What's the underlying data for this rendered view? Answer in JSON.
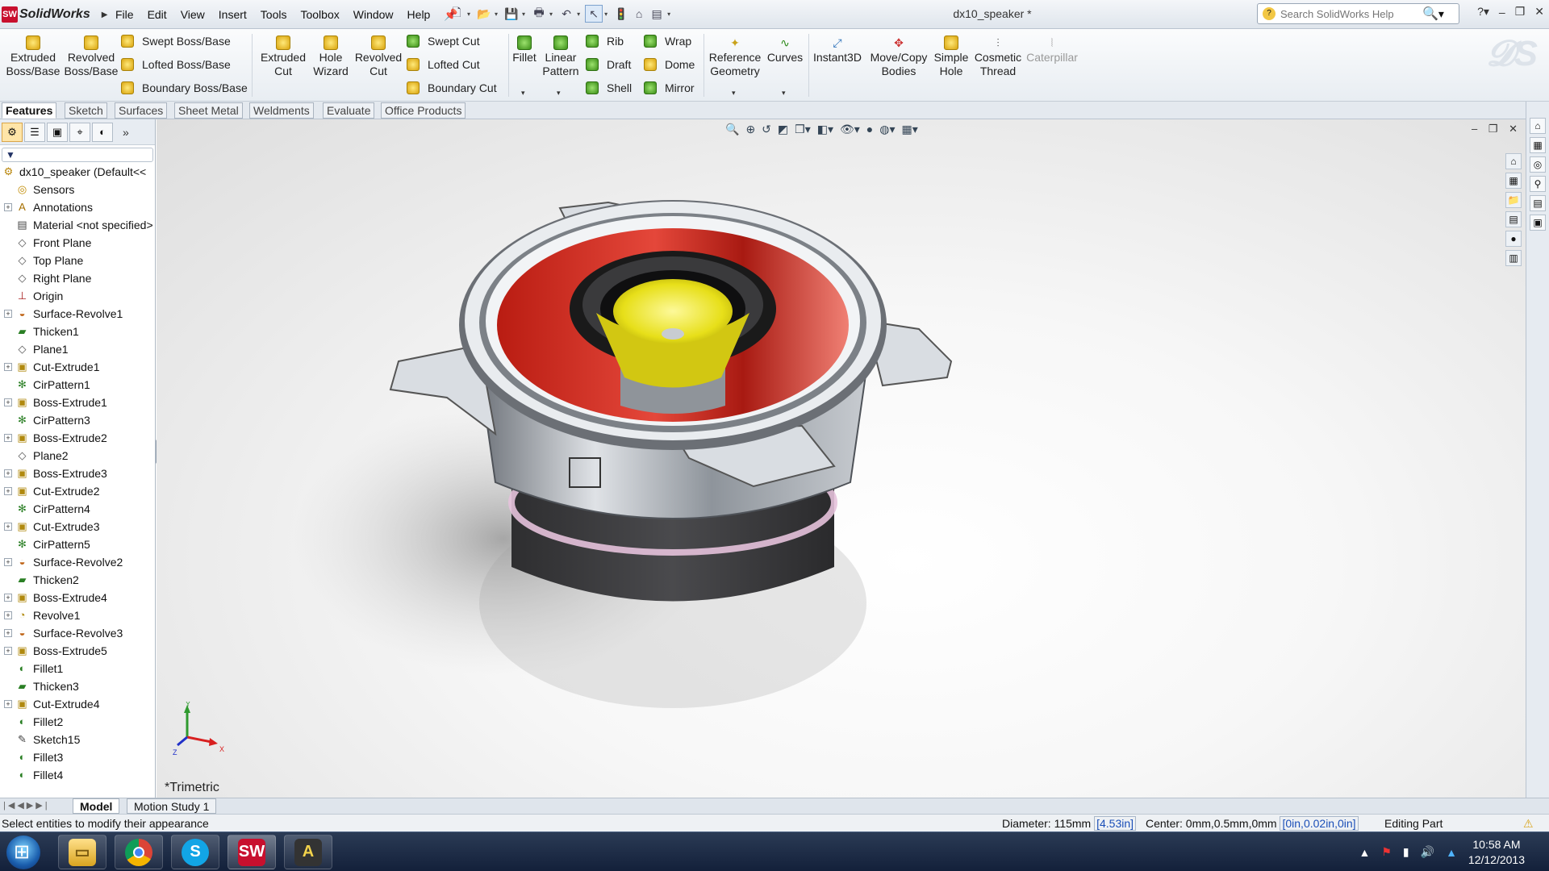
{
  "app": {
    "name": "SolidWorks",
    "document_title": "dx10_speaker *",
    "menus": [
      "File",
      "Edit",
      "View",
      "Insert",
      "Tools",
      "Toolbox",
      "Window",
      "Help"
    ],
    "search_placeholder": "Search SolidWorks Help"
  },
  "command_manager": {
    "big_buttons": [
      {
        "label1": "Extruded",
        "label2": "Boss/Base"
      },
      {
        "label1": "Revolved",
        "label2": "Boss/Base"
      },
      {
        "label1": "Extruded",
        "label2": "Cut"
      },
      {
        "label1": "Hole",
        "label2": "Wizard"
      },
      {
        "label1": "Revolved",
        "label2": "Cut"
      },
      {
        "label1": "Fillet",
        "label2": ""
      },
      {
        "label1": "Linear",
        "label2": "Pattern"
      },
      {
        "label1": "Reference",
        "label2": "Geometry"
      },
      {
        "label1": "Curves",
        "label2": ""
      },
      {
        "label1": "Instant3D",
        "label2": ""
      },
      {
        "label1": "Move/Copy",
        "label2": "Bodies"
      },
      {
        "label1": "Simple",
        "label2": "Hole"
      },
      {
        "label1": "Cosmetic",
        "label2": "Thread"
      },
      {
        "label1": "Caterpillar",
        "label2": ""
      }
    ],
    "small_buttons": [
      "Swept Boss/Base",
      "Lofted Boss/Base",
      "Boundary Boss/Base",
      "Swept Cut",
      "Lofted Cut",
      "Boundary Cut",
      "Rib",
      "Draft",
      "Shell",
      "Wrap",
      "Dome",
      "Mirror"
    ]
  },
  "tabs": [
    "Features",
    "Sketch",
    "Surfaces",
    "Sheet Metal",
    "Weldments",
    "Evaluate",
    "Office Products"
  ],
  "feature_tree": [
    {
      "label": "dx10_speaker  (Default<<",
      "icon": "part-icon",
      "expandable": false,
      "root": true
    },
    {
      "label": "Sensors",
      "icon": "sensor-icon",
      "expandable": false
    },
    {
      "label": "Annotations",
      "icon": "annotation-icon",
      "expandable": true
    },
    {
      "label": "Material <not specified>",
      "icon": "material-icon",
      "expandable": false
    },
    {
      "label": "Front Plane",
      "icon": "plane-icon",
      "expandable": false
    },
    {
      "label": "Top Plane",
      "icon": "plane-icon",
      "expandable": false
    },
    {
      "label": "Right Plane",
      "icon": "plane-icon",
      "expandable": false
    },
    {
      "label": "Origin",
      "icon": "origin-icon",
      "expandable": false
    },
    {
      "label": "Surface-Revolve1",
      "icon": "surface-revolve-icon",
      "expandable": true
    },
    {
      "label": "Thicken1",
      "icon": "thicken-icon",
      "expandable": false
    },
    {
      "label": "Plane1",
      "icon": "plane-icon",
      "expandable": false
    },
    {
      "label": "Cut-Extrude1",
      "icon": "cut-extrude-icon",
      "expandable": true
    },
    {
      "label": "CirPattern1",
      "icon": "circular-pattern-icon",
      "expandable": false
    },
    {
      "label": "Boss-Extrude1",
      "icon": "boss-extrude-icon",
      "expandable": true
    },
    {
      "label": "CirPattern3",
      "icon": "circular-pattern-icon",
      "expandable": false
    },
    {
      "label": "Boss-Extrude2",
      "icon": "boss-extrude-icon",
      "expandable": true
    },
    {
      "label": "Plane2",
      "icon": "plane-icon",
      "expandable": false
    },
    {
      "label": "Boss-Extrude3",
      "icon": "boss-extrude-icon",
      "expandable": true
    },
    {
      "label": "Cut-Extrude2",
      "icon": "cut-extrude-icon",
      "expandable": true
    },
    {
      "label": "CirPattern4",
      "icon": "circular-pattern-icon",
      "expandable": false
    },
    {
      "label": "Cut-Extrude3",
      "icon": "cut-extrude-icon",
      "expandable": true
    },
    {
      "label": "CirPattern5",
      "icon": "circular-pattern-icon",
      "expandable": false
    },
    {
      "label": "Surface-Revolve2",
      "icon": "surface-revolve-icon",
      "expandable": true
    },
    {
      "label": "Thicken2",
      "icon": "thicken-icon",
      "expandable": false
    },
    {
      "label": "Boss-Extrude4",
      "icon": "boss-extrude-icon",
      "expandable": true
    },
    {
      "label": "Revolve1",
      "icon": "revolve-icon",
      "expandable": true
    },
    {
      "label": "Surface-Revolve3",
      "icon": "surface-revolve-icon",
      "expandable": true
    },
    {
      "label": "Boss-Extrude5",
      "icon": "boss-extrude-icon",
      "expandable": true
    },
    {
      "label": "Fillet1",
      "icon": "fillet-icon",
      "expandable": false
    },
    {
      "label": "Thicken3",
      "icon": "thicken-icon",
      "expandable": false
    },
    {
      "label": "Cut-Extrude4",
      "icon": "cut-extrude-icon",
      "expandable": true
    },
    {
      "label": "Fillet2",
      "icon": "fillet-icon",
      "expandable": false
    },
    {
      "label": "Sketch15",
      "icon": "sketch-icon",
      "expandable": false
    },
    {
      "label": "Fillet3",
      "icon": "fillet-icon",
      "expandable": false
    },
    {
      "label": "Fillet4",
      "icon": "fillet-icon",
      "expandable": false
    }
  ],
  "viewport": {
    "view_name": "*Trimetric",
    "axes": {
      "x": "X",
      "y": "Y",
      "z": "Z"
    }
  },
  "bottom_tabs": [
    "Model",
    "Motion Study 1"
  ],
  "status": {
    "message": "Select entities to modify their appearance",
    "diameter_label": "Diameter: 115mm",
    "diameter_in": "[4.53in]",
    "center_label": "Center: 0mm,0.5mm,0mm",
    "center_in": "[0in,0.02in,0in]",
    "mode": "Editing Part"
  },
  "taskbar": {
    "time": "10:58 AM",
    "date": "12/12/2013",
    "apps": [
      "windows-explorer",
      "google-chrome",
      "skype",
      "solidworks",
      "autocad"
    ]
  },
  "colors": {
    "cone_red": "#e23b2b",
    "tweeter_yellow": "#e9e21c",
    "frame_gray": "#9a9fa5",
    "accent_blue": "#1b4fb8"
  }
}
